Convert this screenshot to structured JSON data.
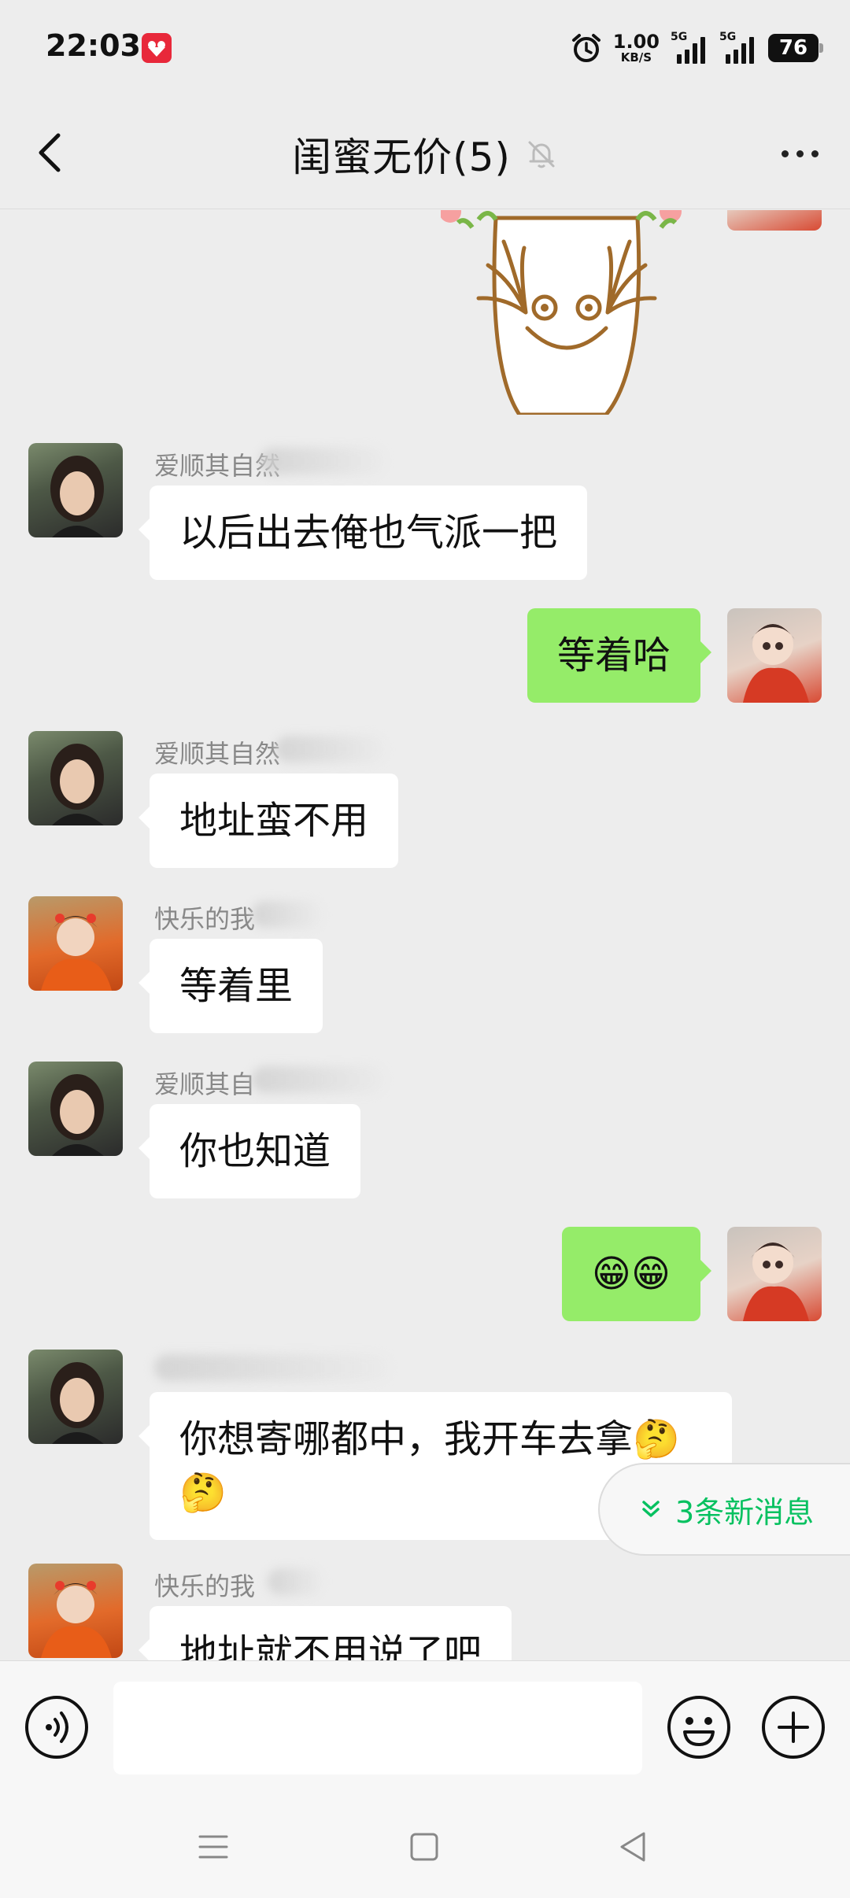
{
  "status_bar": {
    "time": "22:03",
    "net_speed_value": "1.00",
    "net_speed_unit": "KB/S",
    "signal1_label": "5G",
    "signal2_label": "5G",
    "battery": "76"
  },
  "header": {
    "title": "闺蜜无价(5)"
  },
  "messages": [
    {
      "sender": "爱顺其自然",
      "text": "以后出去俺也气派一把"
    },
    {
      "text": "等着哈"
    },
    {
      "sender": "爱顺其自然",
      "text": "地址蛮不用"
    },
    {
      "sender": "快乐的我",
      "text": "等着里"
    },
    {
      "sender": "爱顺其自",
      "text": "你也知道"
    },
    {
      "text": "😁😁"
    },
    {
      "text_line1": "你想寄哪都中，我开车去拿🤔",
      "text_line2": "🤔"
    },
    {
      "sender": "快乐的我",
      "text": "地址就不用说了吧"
    }
  ],
  "new_messages_pill": "3条新消息",
  "colors": {
    "background": "#ededed",
    "out_bubble": "#95ec69",
    "in_bubble": "#ffffff",
    "accent_green": "#07c160"
  },
  "icons": [
    "back-arrow-icon",
    "mute-bell-icon",
    "more-dots-icon",
    "voice-icon",
    "emoji-icon",
    "plus-icon",
    "menu-icon",
    "home-icon",
    "back-triangle-icon",
    "double-chevron-down-icon",
    "alarm-icon"
  ]
}
